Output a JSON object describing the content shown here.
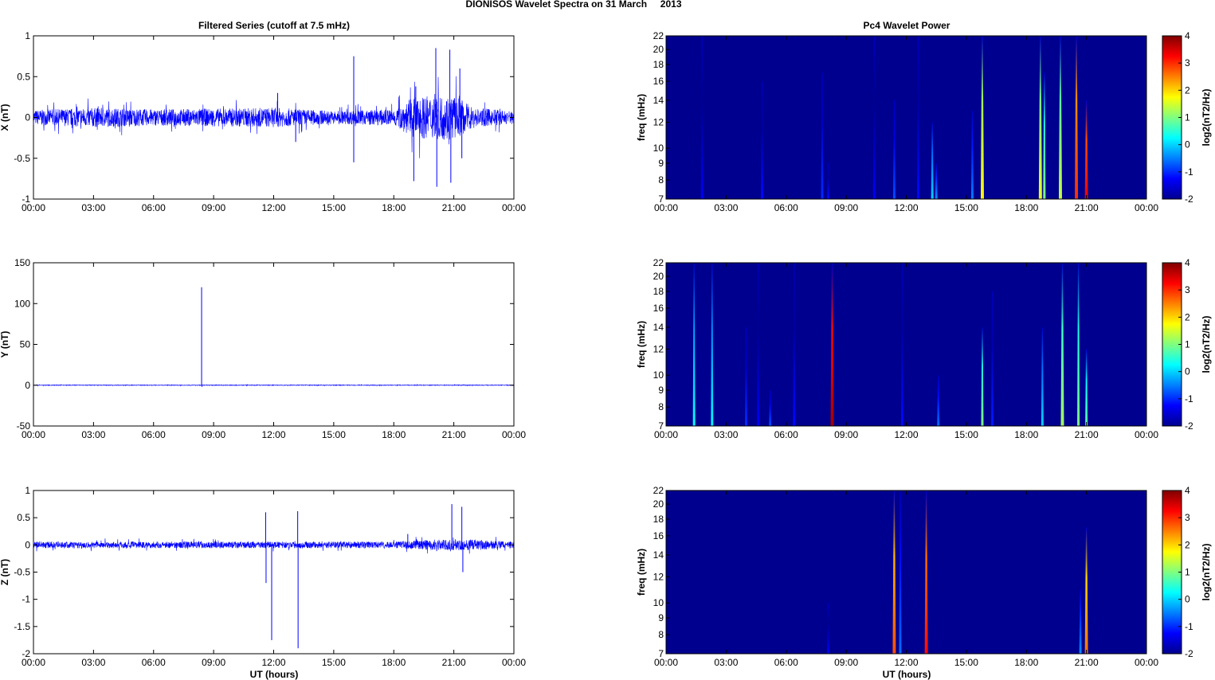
{
  "chart_data": {
    "title": "DIONISOS Wavelet Spectra on 31 March     2013",
    "left_title": "Filtered Series (cutoff at 7.5 mHz)",
    "right_title": "Pc4 Wavelet Power",
    "xlabel": "UT (hours)",
    "xticks": [
      "00:00",
      "03:00",
      "06:00",
      "09:00",
      "12:00",
      "15:00",
      "18:00",
      "21:00",
      "00:00"
    ],
    "xlim": [
      0,
      24
    ],
    "series": [
      {
        "name": "X",
        "type": "line",
        "ylabel": "X (nT)",
        "ylim": [
          -1,
          1
        ],
        "yticks": [
          "-1",
          "-0.5",
          "0",
          "0.5",
          "1"
        ],
        "yvals": [
          -1,
          -0.5,
          0,
          0.5,
          1
        ],
        "noise": 0.1,
        "noise_profile": [
          [
            0,
            0.09
          ],
          [
            3,
            0.12
          ],
          [
            6,
            0.1
          ],
          [
            12,
            0.12
          ],
          [
            15,
            0.08
          ],
          [
            18,
            0.1
          ],
          [
            19,
            0.25
          ],
          [
            21,
            0.28
          ],
          [
            22,
            0.12
          ],
          [
            24,
            0.08
          ]
        ],
        "spikes": [
          [
            16.0,
            0.75
          ],
          [
            16.0,
            -0.55
          ],
          [
            19.0,
            -0.78
          ],
          [
            19.1,
            0.38
          ],
          [
            20.1,
            0.85
          ],
          [
            20.15,
            -0.85
          ],
          [
            20.8,
            0.83
          ],
          [
            20.85,
            -0.8
          ],
          [
            21.3,
            0.6
          ],
          [
            21.4,
            -0.5
          ],
          [
            13.1,
            -0.3
          ],
          [
            12.2,
            0.3
          ]
        ]
      },
      {
        "name": "Y",
        "type": "line",
        "ylabel": "Y (nT)",
        "ylim": [
          -50,
          150
        ],
        "yticks": [
          "-50",
          "0",
          "50",
          "100",
          "150"
        ],
        "yvals": [
          -50,
          0,
          50,
          100,
          150
        ],
        "noise": 0.4,
        "noise_profile": [
          [
            0,
            0.4
          ],
          [
            24,
            0.4
          ]
        ],
        "spikes": [
          [
            8.4,
            120
          ],
          [
            8.42,
            -2
          ]
        ]
      },
      {
        "name": "Z",
        "type": "line",
        "ylabel": "Z (nT)",
        "ylim": [
          -2,
          1
        ],
        "yticks": [
          "-2",
          "-1.5",
          "-1",
          "-0.5",
          "0",
          "0.5",
          "1"
        ],
        "yvals": [
          -2,
          -1.5,
          -1,
          -0.5,
          0,
          0.5,
          1
        ],
        "noise": 0.06,
        "noise_profile": [
          [
            0,
            0.06
          ],
          [
            18,
            0.06
          ],
          [
            20,
            0.1
          ],
          [
            22,
            0.1
          ],
          [
            24,
            0.06
          ]
        ],
        "spikes": [
          [
            11.6,
            0.6
          ],
          [
            11.62,
            -0.7
          ],
          [
            11.9,
            -1.75
          ],
          [
            13.2,
            0.62
          ],
          [
            13.22,
            -1.9
          ],
          [
            20.9,
            0.75
          ],
          [
            21.4,
            0.7
          ],
          [
            21.45,
            -0.5
          ],
          [
            18.7,
            0.2
          ]
        ]
      }
    ],
    "wavelet": {
      "ylabel": "freq (mHz)",
      "ylim": [
        7,
        22
      ],
      "scale": "log",
      "yticks": [
        "7",
        "8",
        "9",
        "10",
        "12",
        "14",
        "16",
        "18",
        "20",
        "22"
      ],
      "yvals": [
        7,
        8,
        9,
        10,
        12,
        14,
        16,
        18,
        20,
        22
      ],
      "colorbar": {
        "label": "log2(nT2/Hz)",
        "range": [
          -2,
          4
        ],
        "ticks": [
          "-2",
          "-1",
          "0",
          "1",
          "2",
          "3",
          "4"
        ],
        "tvals": [
          -2,
          -1,
          0,
          1,
          2,
          3,
          4
        ]
      },
      "panels": [
        {
          "name": "X",
          "bursts": [
            [
              1.8,
              22,
              -1.3
            ],
            [
              4.8,
              16,
              -1.2
            ],
            [
              7.8,
              17,
              -1.0
            ],
            [
              8.1,
              9,
              -1.2
            ],
            [
              11.4,
              14,
              -0.8
            ],
            [
              13.3,
              12,
              0.0
            ],
            [
              13.5,
              9,
              -0.4
            ],
            [
              15.3,
              13,
              -0.5
            ],
            [
              15.8,
              22,
              1.8
            ],
            [
              18.7,
              22,
              1.6
            ],
            [
              18.9,
              17,
              1.0
            ],
            [
              19.7,
              22,
              1.4
            ],
            [
              20.5,
              22,
              3.0
            ],
            [
              21.0,
              14,
              3.4
            ],
            [
              10.4,
              22,
              -1.3
            ],
            [
              12.6,
              22,
              -1.2
            ]
          ]
        },
        {
          "name": "Y",
          "bursts": [
            [
              1.4,
              22,
              0.3
            ],
            [
              2.3,
              22,
              0.2
            ],
            [
              4.0,
              14,
              -1.0
            ],
            [
              5.2,
              9,
              -0.8
            ],
            [
              4.6,
              22,
              -1.3
            ],
            [
              6.4,
              22,
              -1.2
            ],
            [
              8.3,
              22,
              3.8
            ],
            [
              11.8,
              22,
              -1.2
            ],
            [
              13.6,
              10,
              -0.6
            ],
            [
              15.8,
              14,
              1.0
            ],
            [
              16.3,
              18,
              -1.1
            ],
            [
              18.8,
              14,
              0.0
            ],
            [
              19.8,
              22,
              1.2
            ],
            [
              20.6,
              22,
              1.0
            ],
            [
              21.0,
              12,
              0.8
            ]
          ]
        },
        {
          "name": "Z",
          "bursts": [
            [
              8.1,
              10,
              -1.3
            ],
            [
              11.4,
              22,
              2.8
            ],
            [
              11.7,
              22,
              -0.6
            ],
            [
              13.0,
              22,
              3.2
            ],
            [
              20.7,
              11,
              -0.4
            ],
            [
              21.0,
              17,
              2.6
            ]
          ]
        }
      ]
    }
  }
}
